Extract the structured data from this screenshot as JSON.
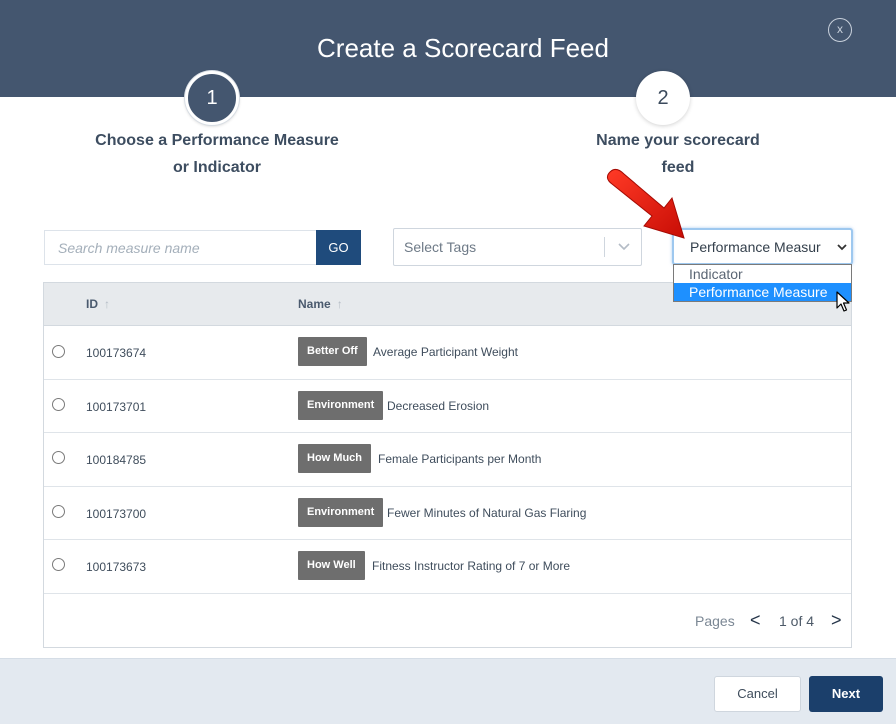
{
  "dialog": {
    "title": "Create a Scorecard Feed",
    "close_label": "x"
  },
  "steps": [
    {
      "number": "1",
      "label_line1": "Choose a Performance Measure",
      "label_line2": "or Indicator"
    },
    {
      "number": "2",
      "label_line1": "Name your scorecard",
      "label_line2": "feed"
    }
  ],
  "search": {
    "placeholder": "Search measure name",
    "value": "",
    "go_label": "GO"
  },
  "tags": {
    "placeholder": "Select Tags"
  },
  "type_select": {
    "value": "Performance Measur",
    "options": [
      "Indicator",
      "Performance Measure"
    ],
    "highlighted": "Performance Measure"
  },
  "table": {
    "columns": [
      "ID",
      "Name"
    ],
    "sort_glyph": "↑",
    "rows": [
      {
        "id": "100173674",
        "badge": "Better Off",
        "name": "Average Participant Weight"
      },
      {
        "id": "100173701",
        "badge": "Environment",
        "name": "Decreased Erosion"
      },
      {
        "id": "100184785",
        "badge": "How Much",
        "name": "Female Participants per Month"
      },
      {
        "id": "100173700",
        "badge": "Environment",
        "name": "Fewer Minutes of Natural Gas Flaring"
      },
      {
        "id": "100173673",
        "badge": "How Well",
        "name": "Fitness Instructor Rating of 7 or More"
      }
    ]
  },
  "pager": {
    "label": "Pages",
    "prev": "<",
    "current": "1 of 4",
    "next": ">"
  },
  "footer": {
    "cancel_label": "Cancel",
    "next_label": "Next"
  },
  "colors": {
    "header": "#44566f",
    "primary": "#1b3f6b",
    "badge": "#6e6e6e",
    "arrow": "#e0170e",
    "dropdown_highlight": "#1e90ff"
  },
  "icons": [
    "close-icon",
    "chevron-down-icon",
    "sort-up-icon",
    "red-arrow-annotation",
    "mouse-cursor-icon"
  ]
}
